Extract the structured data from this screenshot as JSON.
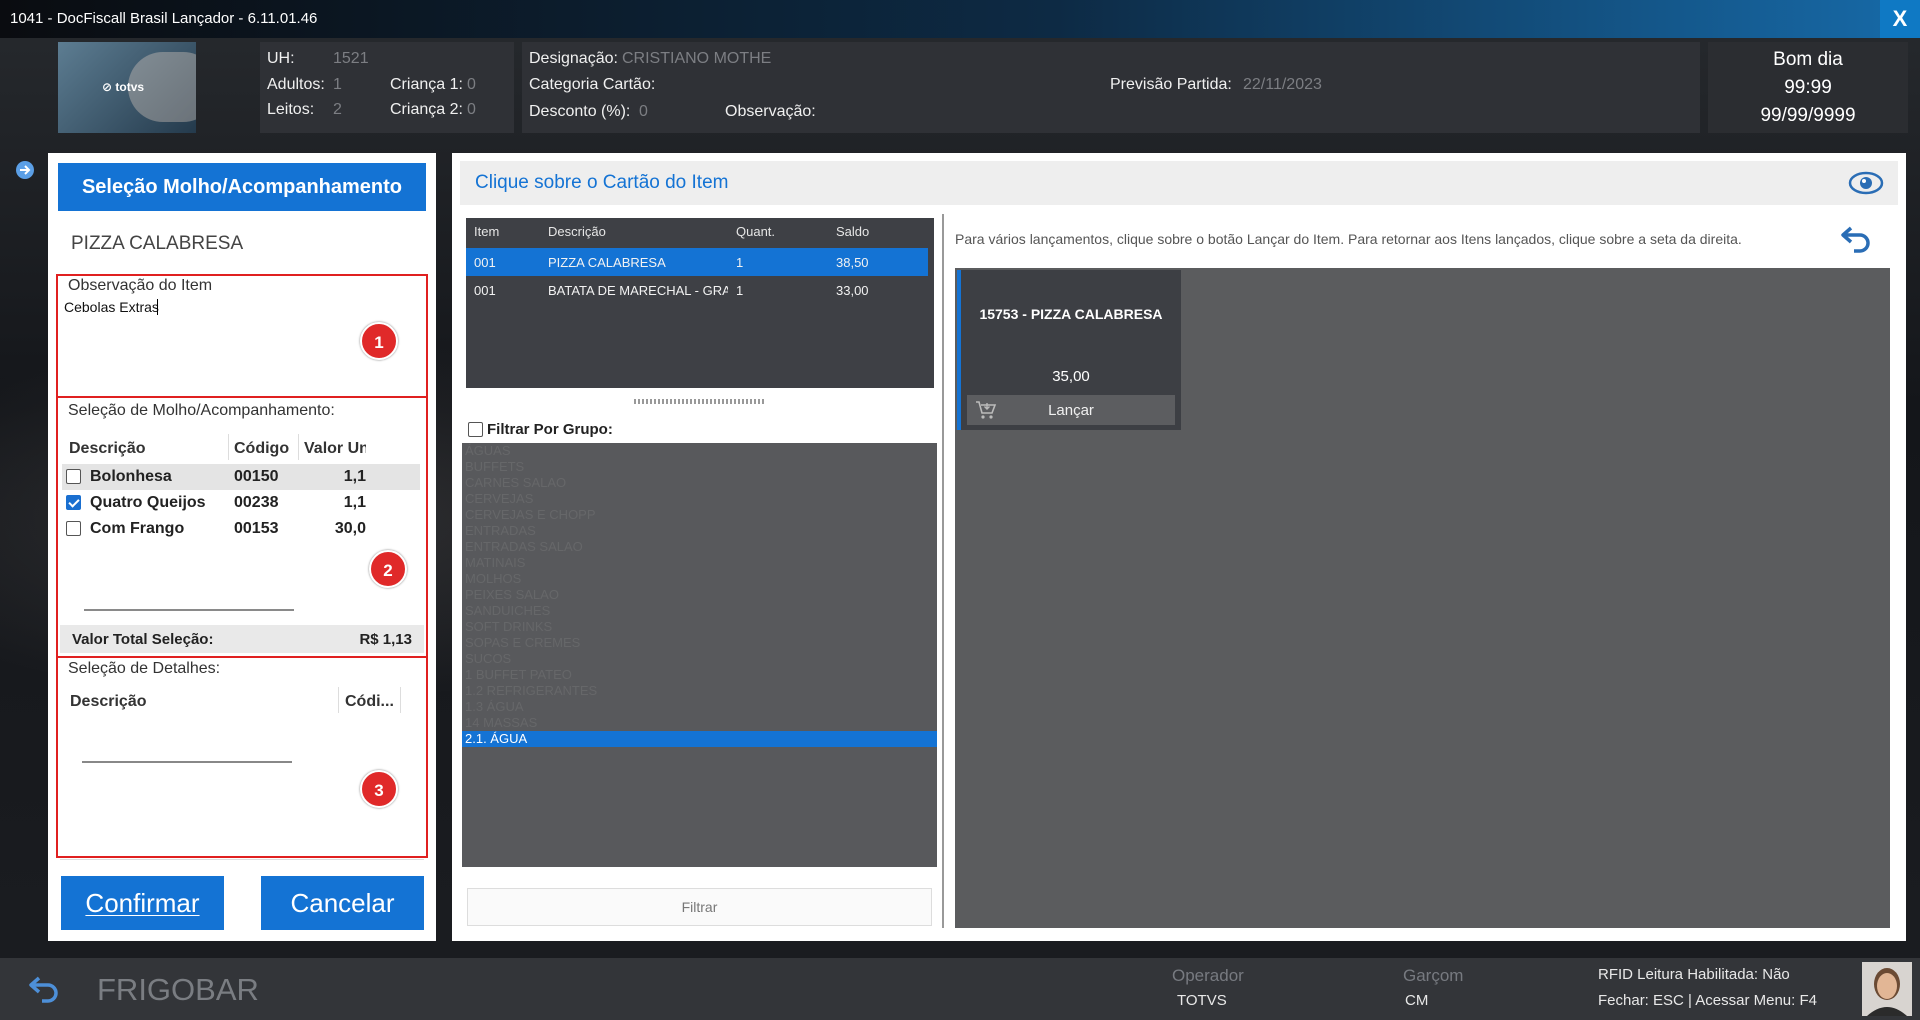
{
  "window": {
    "title": "1041 - DocFiscall Brasil Lançador - 6.11.01.46",
    "close_label": "X"
  },
  "logo": {
    "text": "⊘ totvs"
  },
  "guest": {
    "uh_label": "UH:",
    "uh_value": "1521",
    "adultos_label": "Adultos:",
    "adultos_value": "1",
    "crianca1_label": "Criança 1:",
    "crianca1_value": "0",
    "leitos_label": "Leitos:",
    "leitos_value": "2",
    "crianca2_label": "Criança 2:",
    "crianca2_value": "0"
  },
  "booking": {
    "designacao_label": "Designação:",
    "designacao_value": "CRISTIANO MOTHE",
    "categoria_label": "Categoria Cartão:",
    "previsao_label": "Previsão Partida:",
    "previsao_value": "22/11/2023",
    "desconto_label": "Desconto (%):",
    "desconto_value": "0",
    "observacao_label": "Observação:"
  },
  "greeting": {
    "text": "Bom dia",
    "time": "99:99",
    "date": "99/99/9999"
  },
  "left": {
    "header_button": "Seleção Molho/Acompanhamento",
    "item_name": "PIZZA CALABRESA",
    "obs_label": "Observação do Item",
    "obs_value": "Cebolas Extras",
    "molho_label": "Seleção de Molho/Acompanhamento:",
    "molho_columns": [
      "Descrição",
      "Código",
      "Valor Un"
    ],
    "molho_rows": [
      {
        "desc": "Bolonhesa",
        "code": "00150",
        "value": "1,1",
        "checked": false
      },
      {
        "desc": "Quatro Queijos",
        "code": "00238",
        "value": "1,1",
        "checked": true
      },
      {
        "desc": "Com Frango",
        "code": "00153",
        "value": "30,0",
        "checked": false
      }
    ],
    "total_label": "Valor Total Seleção:",
    "total_value": "R$ 1,13",
    "detalhes_label": "Seleção de Detalhes:",
    "detalhes_columns": [
      "Descrição",
      "Códi..."
    ],
    "confirm_label": "Confirmar",
    "cancel_label": "Cancelar",
    "badges": [
      "1",
      "2",
      "3"
    ]
  },
  "right": {
    "title": "Clique sobre o Cartão do Item",
    "hint": "Para vários lançamentos, clique sobre o botão Lançar do Item. Para retornar aos Itens lançados, clique sobre a seta da direita.",
    "grid_columns": [
      "Item",
      "Descrição",
      "Quant.",
      "Saldo"
    ],
    "grid_rows": [
      {
        "item": "001",
        "desc": "PIZZA CALABRESA",
        "qty": "1",
        "saldo": "38,50",
        "selected": true
      },
      {
        "item": "001",
        "desc": "BATATA DE MARECHAL - GRA",
        "qty": "1",
        "saldo": "33,00",
        "selected": false
      }
    ],
    "filter_group_label": "Filtrar Por Grupo:",
    "groups": [
      "ÁGUAS",
      "BUFFETS",
      "CARNES SALAO",
      "CERVEJAS",
      "CERVEJAS E CHOPP",
      "ENTRADAS",
      "ENTRADAS SALAO",
      "MATINAIS",
      "MOLHOS",
      "PEIXES SALAO",
      "SANDUICHES",
      "SOFT DRINKS",
      "SOPAS E CREMES",
      "SUCOS",
      "1 BUFFET PATEO",
      "1.2 REFRIGERANTES",
      "1.3 ÁGUA",
      "14 MASSAS",
      "2.1. ÁGUA"
    ],
    "selected_group": "2.1. ÁGUA",
    "filter_button": "Filtrar",
    "card": {
      "title": "15753 - PIZZA CALABRESA",
      "price": "35,00",
      "action": "Lançar"
    }
  },
  "footer": {
    "back_label": "FRIGOBAR",
    "operador_label": "Operador",
    "operador_value": "TOTVS",
    "garcom_label": "Garçom",
    "garcom_value": "CM",
    "rfid_text": "RFID Leitura Habilitada: Não",
    "shortcuts_text": "Fechar: ESC | Acessar Menu: F4"
  }
}
